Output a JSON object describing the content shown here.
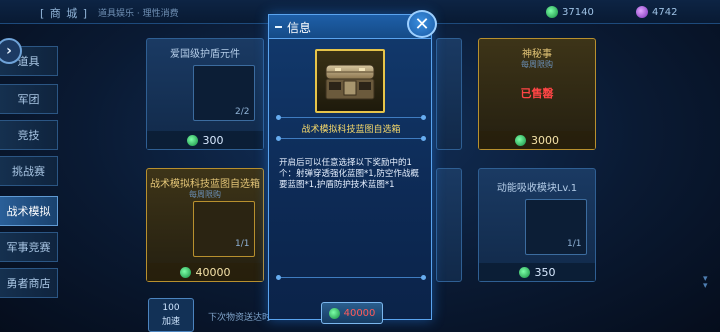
{
  "header": {
    "title": "[ 商 城 ]",
    "breadcrumb": "道具娱乐 · 理性消费",
    "credits": "37140",
    "gems": "4742"
  },
  "sidebar": {
    "items": [
      {
        "label": "道具"
      },
      {
        "label": "军团"
      },
      {
        "label": "竞技"
      },
      {
        "label": "挑战赛"
      },
      {
        "label": "战术模拟"
      },
      {
        "label": "军事竞赛"
      },
      {
        "label": "勇者商店"
      }
    ],
    "active_index": 4
  },
  "shop": {
    "cards": [
      {
        "title": "爱国级护盾元件",
        "sub": "",
        "qty": "2/2",
        "price": "300"
      },
      {
        "title": "",
        "sub": "",
        "qty": "",
        "price": ""
      },
      {
        "title": "",
        "sub": "",
        "qty": "",
        "price": ""
      },
      {
        "title": "神秘事",
        "sub": "每周限购",
        "qty": "",
        "price": "3000",
        "soldout": "已售罄"
      },
      {
        "title": "战术模拟科技蓝图自选箱",
        "sub": "每周限购",
        "qty": "1/1",
        "price": "40000"
      },
      {
        "title": "",
        "sub": "",
        "qty": "",
        "price": ""
      },
      {
        "title": "",
        "sub": "",
        "qty": "",
        "price": ""
      },
      {
        "title": "动能吸收模块Lv.1",
        "sub": "",
        "qty": "1/1",
        "price": "350"
      }
    ],
    "footer_button_top": "100",
    "footer_button_bottom": "加速",
    "footer_note": "下次物资送达时"
  },
  "modal": {
    "title": "信息",
    "close_label": "✕",
    "item_name": "战术模拟科技蓝图自选箱",
    "description": "开启后可以任意选择以下奖励中的1个：射弹穿透强化蓝图*1,防空作战概要蓝图*1,护盾防护技术蓝图*1",
    "price": "40000"
  },
  "colors": {
    "accent": "#5aa4ef",
    "gold": "#e6c44a",
    "price_insufficient": "#ff5a5a",
    "credit": "#2fd16a"
  },
  "icons": {
    "credit": "credit-coin-icon",
    "gem": "gem-icon",
    "close": "close-icon",
    "back": "back-chevron-icon"
  }
}
